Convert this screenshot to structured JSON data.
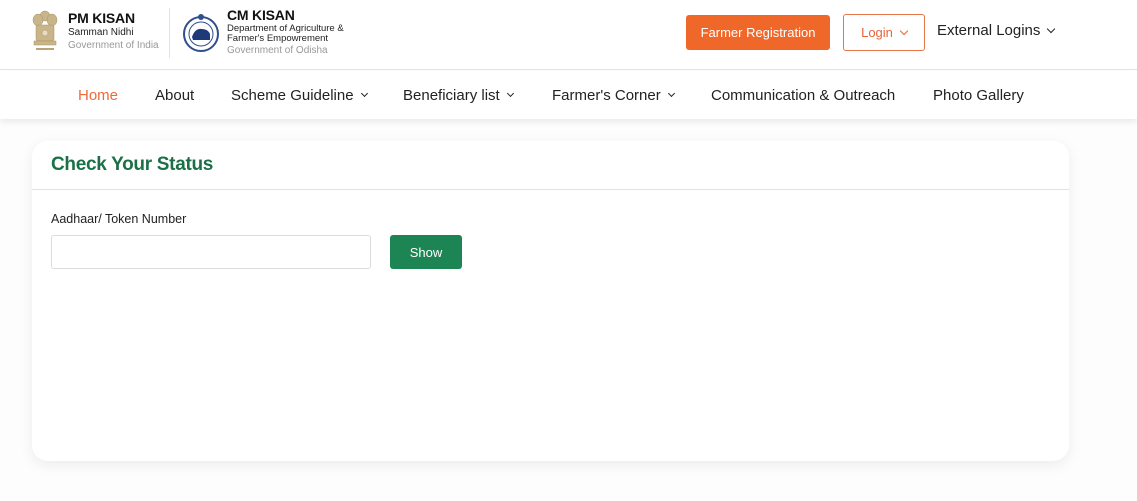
{
  "header": {
    "pm_kisan": {
      "title": "PM KISAN",
      "subtitle": "Samman Nidhi",
      "government": "Government of India",
      "logo_icon": "national-emblem-icon"
    },
    "cm_kisan": {
      "title": "CM KISAN",
      "subtitle_line1": "Department of Agriculture &",
      "subtitle_line2": "Farmer's Empowrement",
      "government": "Government of Odisha",
      "logo_icon": "odisha-seal-icon"
    },
    "farmer_registration_label": "Farmer Registration",
    "login_label": "Login",
    "external_logins_label": "External Logins"
  },
  "nav": {
    "items": [
      {
        "label": "Home",
        "active": true,
        "dropdown": false
      },
      {
        "label": "About",
        "active": false,
        "dropdown": false
      },
      {
        "label": "Scheme Guideline",
        "active": false,
        "dropdown": true
      },
      {
        "label": "Beneficiary list",
        "active": false,
        "dropdown": true
      },
      {
        "label": "Farmer's Corner",
        "active": false,
        "dropdown": true
      },
      {
        "label": "Communication & Outreach",
        "active": false,
        "dropdown": false
      },
      {
        "label": "Photo Gallery",
        "active": false,
        "dropdown": false
      }
    ]
  },
  "status_card": {
    "title": "Check Your Status",
    "field_label": "Aadhaar/ Token Number",
    "field_value": "",
    "field_placeholder": "",
    "show_label": "Show"
  },
  "colors": {
    "accent_orange": "#f0672a",
    "brand_green": "#1b7048",
    "button_green": "#1d8454"
  }
}
